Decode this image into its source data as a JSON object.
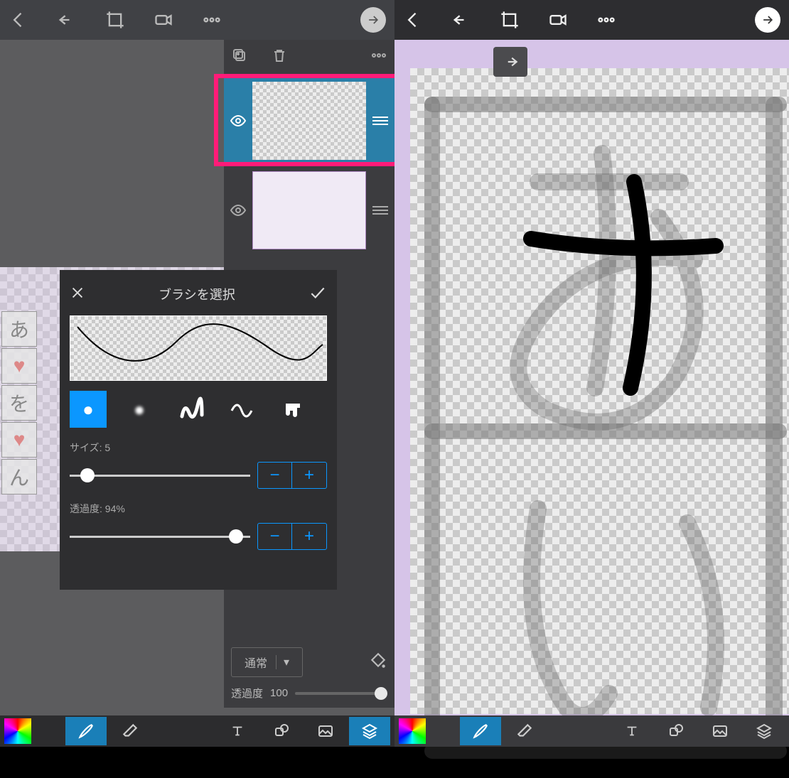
{
  "left": {
    "topbar": {
      "back": "back",
      "undo": "undo",
      "crop": "crop",
      "record": "record",
      "more": "more",
      "next": "next"
    },
    "layers": {
      "toolbar": {
        "add": "add-layer",
        "delete": "delete",
        "more": "more"
      },
      "items": [
        {
          "name": "layer-1",
          "selected": true
        },
        {
          "name": "layer-2",
          "selected": false
        }
      ],
      "blend_mode": "通常",
      "opacity_label": "透過度",
      "opacity_value": "100"
    },
    "brush_popup": {
      "title": "ブラシを選択",
      "types": [
        "solid",
        "soft",
        "scribble",
        "wave",
        "drip"
      ],
      "size_label": "サイズ: ",
      "size_value": "5",
      "opacity_label": "透過度: ",
      "opacity_value": "94%",
      "minus": "−",
      "plus": "+"
    },
    "bottom": {
      "color": "color-picker",
      "brush": "brush",
      "eraser": "eraser",
      "text": "text",
      "shape": "shape",
      "image": "image",
      "layers": "layers"
    },
    "side_chars": [
      "あ",
      "♥",
      "を",
      "♥",
      "ん"
    ]
  },
  "right": {
    "topbar": {
      "back": "back",
      "undo": "undo",
      "crop": "crop",
      "record": "record",
      "more": "more",
      "next": "next"
    },
    "redo": "redo",
    "canvas_chars": {
      "top": "あ",
      "bottom": "い"
    },
    "bottom": {
      "color": "color-picker",
      "brush": "brush",
      "eraser": "eraser",
      "text": "text",
      "shape": "shape",
      "image": "image",
      "layers": "layers"
    }
  }
}
